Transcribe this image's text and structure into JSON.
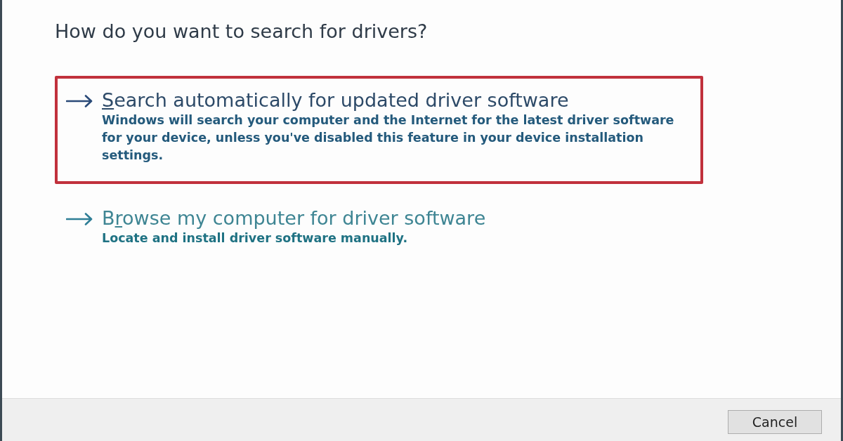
{
  "dialog": {
    "heading": "How do you want to search for drivers?"
  },
  "options": [
    {
      "title": {
        "key": "S",
        "after": "earch automatically for updated driver software"
      },
      "description": "Windows will search your computer and the Internet for the latest driver software for your device, unless you've disabled this feature in your device installation settings.",
      "hovered": true,
      "annotated": true
    },
    {
      "title": {
        "before": "B",
        "key": "r",
        "after": "owse my computer for driver software"
      },
      "description": "Locate and install driver software manually.",
      "hovered": false,
      "annotated": false
    }
  ],
  "buttons": [
    {
      "label": "Cancel"
    }
  ]
}
